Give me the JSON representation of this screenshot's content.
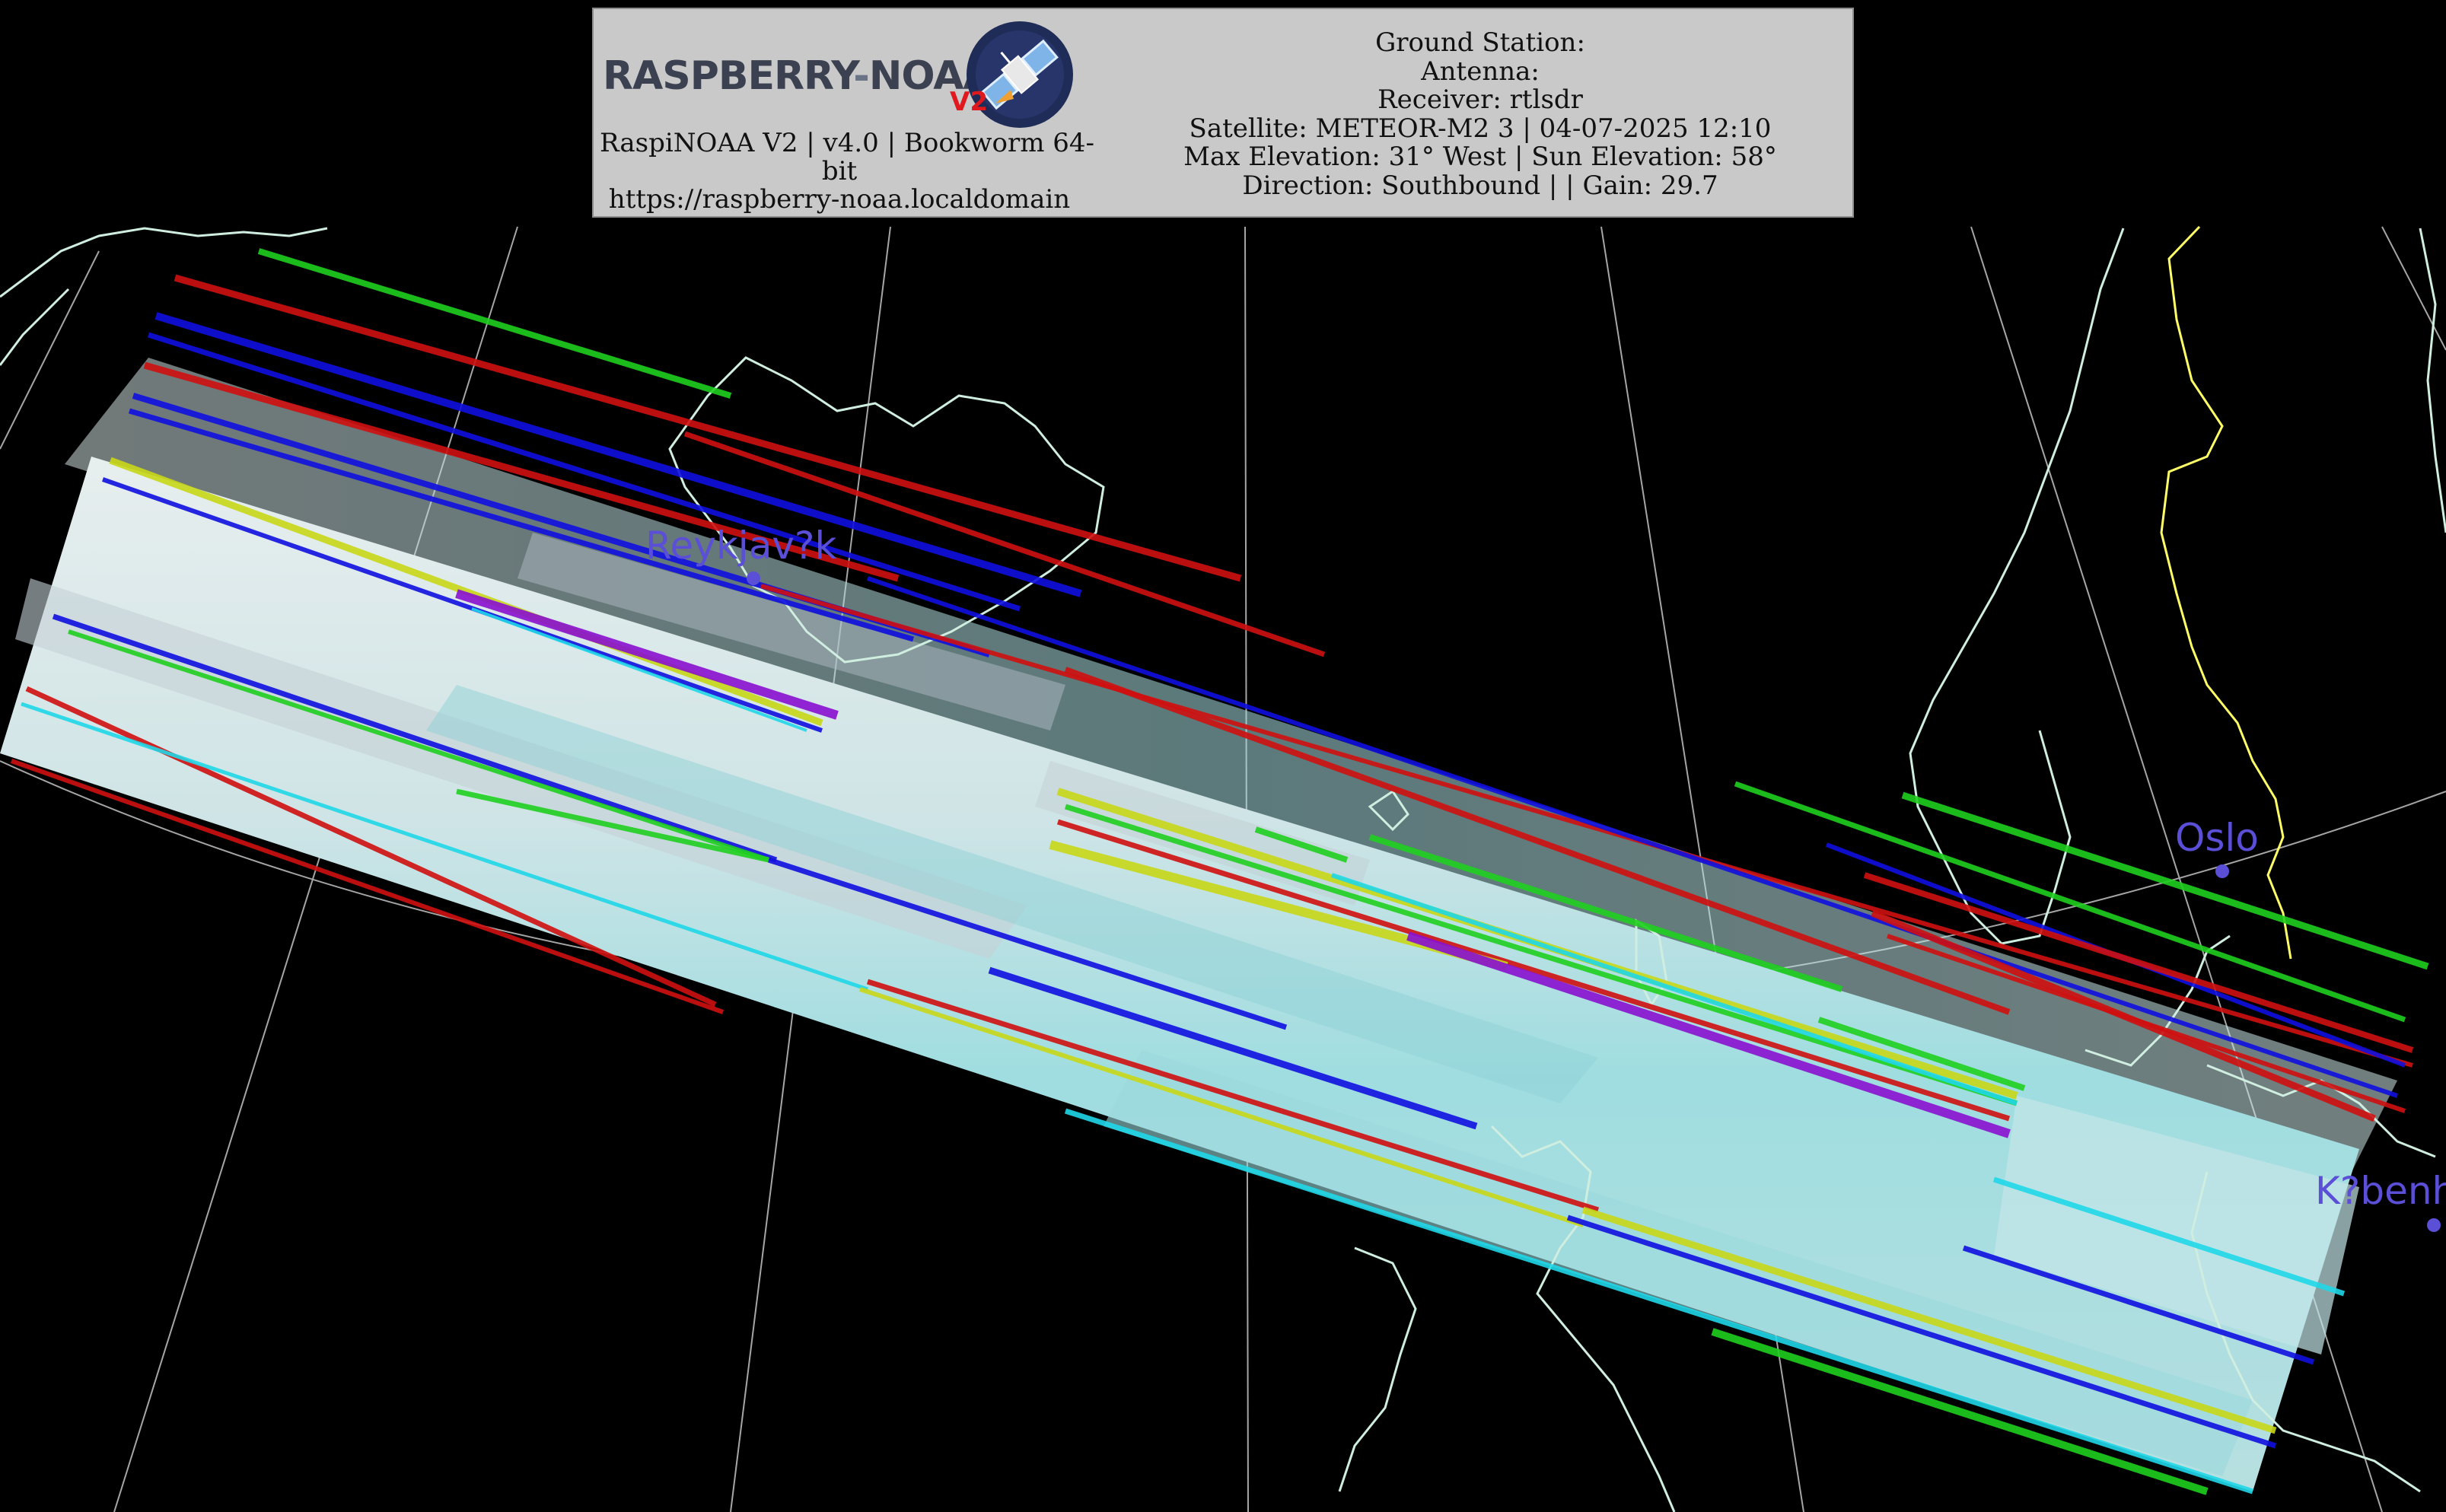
{
  "header": {
    "logo": {
      "wordmark_part1": "RASPBERRY",
      "wordmark_dash": "-",
      "wordmark_part2": "NOAA",
      "version_badge": "V2",
      "badge_icon": "satellite-icon"
    },
    "left_lines": [
      "RaspiNOAA V2 | v4.0 | Bookworm 64-",
      "bit",
      "https://raspberry-noaa.localdomain"
    ],
    "right_lines": [
      "Ground Station:",
      "Antenna:",
      "Receiver: rtlsdr",
      "Satellite: METEOR-M2 3 | 04-07-2025 12:10",
      "Max Elevation: 31° West | Sun Elevation: 58°",
      "Direction: Southbound | | Gain: 29.7"
    ]
  },
  "map": {
    "cities": [
      {
        "name": "Reykjav?k",
        "color": "#5a4fd6"
      },
      {
        "name": "Oslo",
        "color": "#5a4fd6"
      },
      {
        "name": "K?benhavn",
        "color": "#5a4fd6"
      }
    ],
    "coastline_color": "#cfeee0",
    "border_color": "#ffff66",
    "graticule_color": "#d0d0d0",
    "swath_colors": {
      "cloud_light": "#dfeaea",
      "cloud_cyan": "#7fd8dc",
      "artifact_red": "#d01010",
      "artifact_blue": "#1010e0",
      "artifact_green": "#20d020",
      "artifact_yellow": "#c8d818",
      "artifact_cyan": "#20d8e8",
      "artifact_purple": "#8a10d0"
    }
  }
}
